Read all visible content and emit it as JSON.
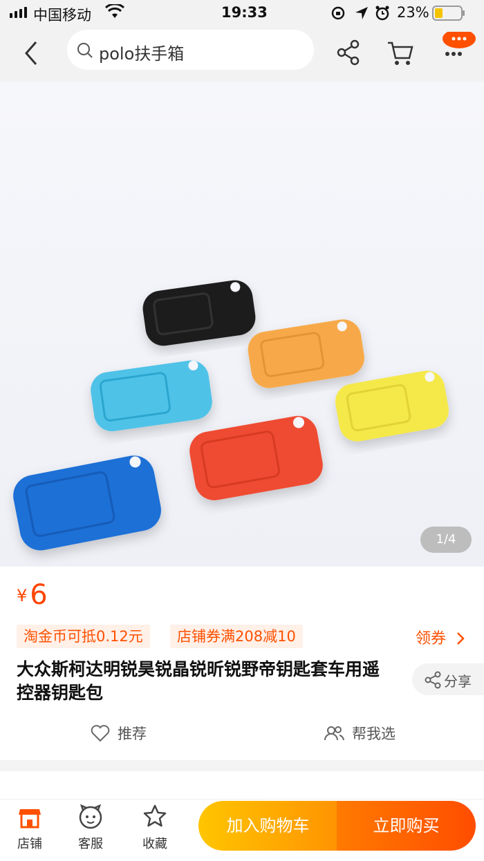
{
  "status_bar": {
    "carrier": "中国移动",
    "time": "19:33",
    "battery": "23%"
  },
  "nav": {
    "search_text": "polo扶手箱"
  },
  "gallery": {
    "pager": "1/4"
  },
  "product": {
    "currency": "¥",
    "price": "6",
    "tag_coin": "淘金币可抵0.12元",
    "tag_coupon": "店铺券满208减10",
    "get_coupon": "领券",
    "title": "大众斯柯达明锐昊锐晶锐昕锐野帝钥匙套车用遥控器钥匙包",
    "share_label": "分享",
    "recommend_label": "推荐",
    "help_choose_label": "帮我选"
  },
  "bottom_bar": {
    "shop_label": "店铺",
    "service_label": "客服",
    "favorite_label": "收藏",
    "add_to_cart": "加入购物车",
    "buy_now": "立即购买"
  },
  "colors": {
    "accent": "#ff5000",
    "cart_button": "#ffa200",
    "buy_button": "#ff5a00"
  }
}
